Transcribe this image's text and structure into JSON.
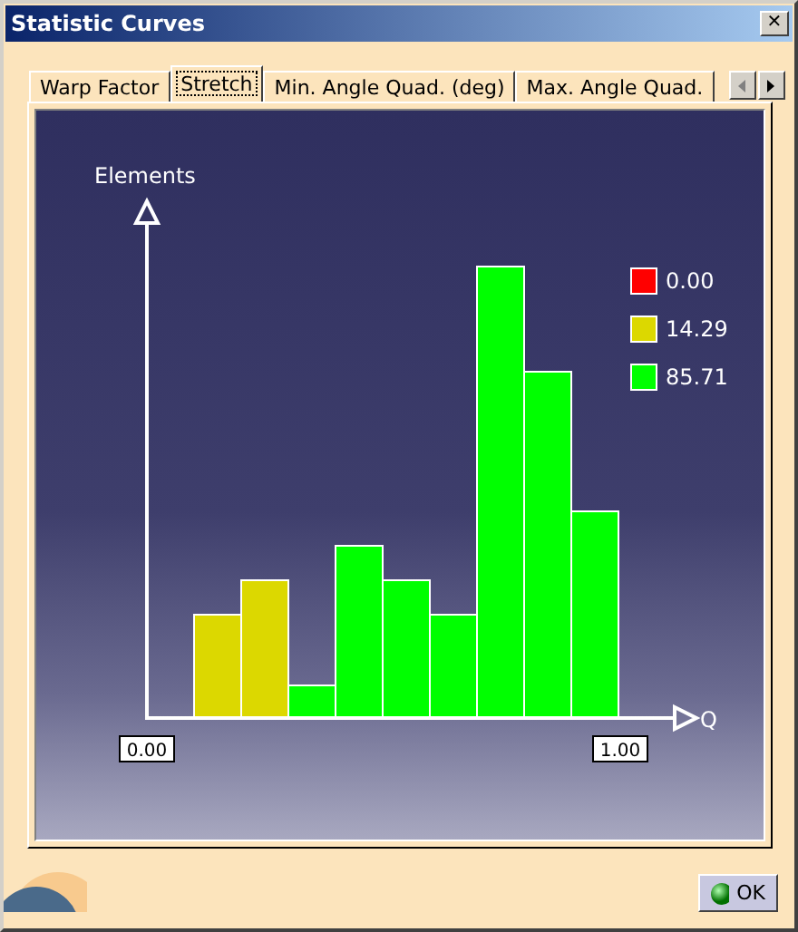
{
  "window": {
    "title": "Statistic Curves",
    "close": "✕"
  },
  "tabs": [
    {
      "label": "Warp Factor",
      "selected": false
    },
    {
      "label": "Stretch",
      "selected": true
    },
    {
      "label": "Min. Angle Quad. (deg)",
      "selected": false
    },
    {
      "label": "Max. Angle Quad.",
      "selected": false
    }
  ],
  "chart": {
    "ylabel": "Elements",
    "xlabel": "Q",
    "xmin": "0.00",
    "xmax": "1.00",
    "legend": [
      {
        "label": "0.00",
        "color": "#ff0000"
      },
      {
        "label": "14.29",
        "color": "#dcd800"
      },
      {
        "label": "85.71",
        "color": "#00ff00"
      }
    ]
  },
  "ok_button": {
    "label": "OK"
  }
}
